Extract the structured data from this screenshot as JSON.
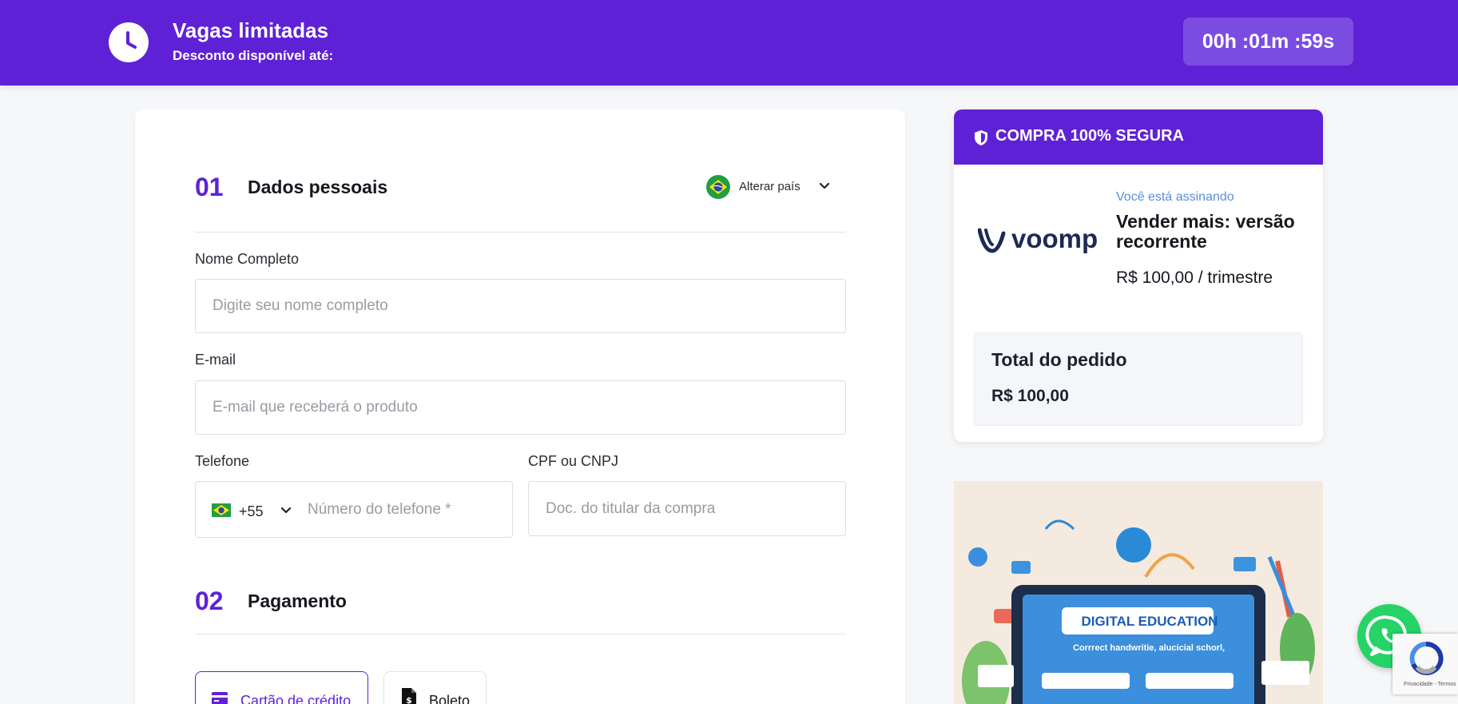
{
  "topbar": {
    "title": "Vagas limitadas",
    "subtitle": "Desconto disponível até:",
    "timer": "00h :01m :59s"
  },
  "personal": {
    "number": "01",
    "title": "Dados pessoais",
    "country_label": "Alterar país",
    "name_label": "Nome Completo",
    "name_placeholder": "Digite seu nome completo",
    "email_label": "E-mail",
    "email_placeholder": "E-mail que receberá o produto",
    "phone_label": "Telefone",
    "phone_ddi": "+55",
    "phone_placeholder": "Número do telefone *",
    "doc_label": "CPF ou CNPJ",
    "doc_placeholder": "Doc. do titular da compra"
  },
  "payment": {
    "number": "02",
    "title": "Pagamento",
    "methods": [
      {
        "label": "Cartão de crédito",
        "selected": true
      },
      {
        "label": "Boleto",
        "selected": false
      }
    ]
  },
  "summary": {
    "header": "COMPRA 100% SEGURA",
    "logo_text": "voomp",
    "subscribe_label": "Você está assinando",
    "product_name": "Vender mais: versão recorrente",
    "product_price": "R$ 100,00 / trimestre",
    "total_label": "Total do pedido",
    "total_value": "R$ 100,00"
  },
  "banner": {
    "title": "DIGITAL EDUCATION",
    "subtitle": "Corrrect handwritie, alucicial schorl,"
  },
  "recaptcha": {
    "text": "Privacidade - Termos"
  },
  "colors": {
    "brand": "#5f21d6",
    "timer_bg": "#7b4ce0",
    "whatsapp": "#25d366"
  },
  "icons": [
    "clock-icon",
    "brazil-flag-icon",
    "chevron-down-icon",
    "credit-card-icon",
    "boleto-icon",
    "shield-icon",
    "voomp-logo",
    "whatsapp-icon",
    "recaptcha-icon"
  ]
}
